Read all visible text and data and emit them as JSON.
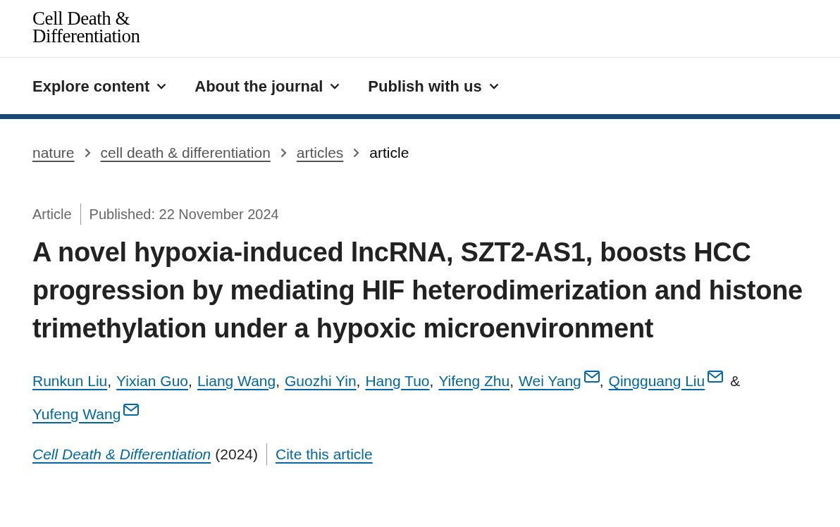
{
  "logo": {
    "lines": [
      "Cell Death &",
      "Differentiation"
    ]
  },
  "nav": [
    {
      "label": "Explore content"
    },
    {
      "label": "About the journal"
    },
    {
      "label": "Publish with us"
    }
  ],
  "breadcrumb": [
    {
      "label": "nature",
      "link": true
    },
    {
      "label": "cell death & differentiation",
      "link": true
    },
    {
      "label": "articles",
      "link": true
    },
    {
      "label": "article",
      "link": false
    }
  ],
  "meta": {
    "type": "Article",
    "published": "Published: 22 November 2024"
  },
  "title": "A novel hypoxia-induced lncRNA, SZT2-AS1, boosts HCC progression by mediating HIF heterodimerization and histone trimethylation under a hypoxic microenvironment",
  "authors": [
    {
      "name": "Runkun Liu",
      "email": false,
      "sep": ","
    },
    {
      "name": "Yixian Guo",
      "email": false,
      "sep": ","
    },
    {
      "name": "Liang Wang",
      "email": false,
      "sep": ","
    },
    {
      "name": "Guozhi Yin",
      "email": false,
      "sep": ","
    },
    {
      "name": "Hang Tuo",
      "email": false,
      "sep": ","
    },
    {
      "name": "Yifeng Zhu",
      "email": false,
      "sep": ","
    },
    {
      "name": "Wei Yang",
      "email": true,
      "sep": ","
    },
    {
      "name": "Qingguang Liu",
      "email": true,
      "sep": "&"
    },
    {
      "name": "Yufeng Wang",
      "email": true
    }
  ],
  "citation": {
    "journal": "Cell Death & Differentiation",
    "year": "(2024)",
    "cite": "Cite this article"
  }
}
